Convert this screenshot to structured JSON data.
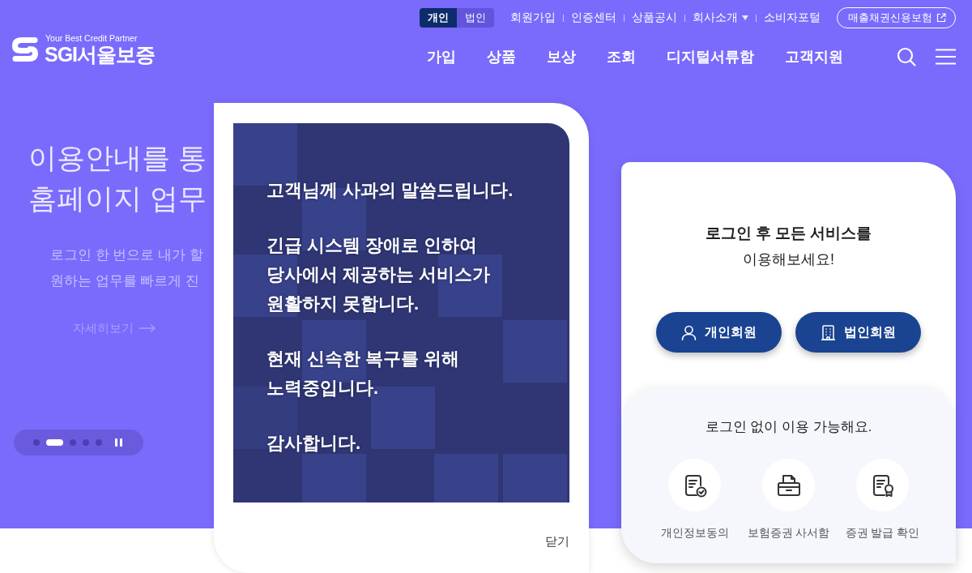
{
  "header": {
    "member_tabs": [
      {
        "label": "개인",
        "selected": true
      },
      {
        "label": "법인",
        "selected": false
      }
    ],
    "utility_links": [
      {
        "label": "회원가입",
        "kind": "link"
      },
      {
        "label": "인증센터",
        "kind": "link"
      },
      {
        "label": "상품공시",
        "kind": "link"
      },
      {
        "label": "회사소개",
        "kind": "dropdown"
      },
      {
        "label": "소비자포털",
        "kind": "link"
      }
    ],
    "external_button": {
      "label": "매출채권신용보험"
    },
    "logo": {
      "tagline": "Your Best Credit Partner",
      "name": "SGI서울보증"
    },
    "nav": [
      "가입",
      "상품",
      "보상",
      "조회",
      "디지털서류함",
      "고객지원"
    ]
  },
  "hero": {
    "headline": [
      "이용안내를 통",
      "홈페이지 업무"
    ],
    "description": [
      "로그인 한 번으로 내가 할",
      "원하는 업무를 빠르게 진"
    ],
    "more_link": "자세히보기",
    "carousel": {
      "slides": [
        {
          "selected": false
        },
        {
          "selected": true
        },
        {
          "selected": false
        },
        {
          "selected": false
        },
        {
          "selected": false
        }
      ],
      "playing": true
    }
  },
  "popup": {
    "paragraphs": [
      [
        "고객님께 사과의 말씀드립니다."
      ],
      [
        "긴급 시스템 장애로 인하여",
        "당사에서 제공하는 서비스가",
        "원활하지 못합니다."
      ],
      [
        "현재 신속한 복구를 위해",
        "노력중입니다."
      ],
      [
        "감사합니다."
      ]
    ],
    "close": "닫기"
  },
  "login_card": {
    "title": "로그인 후 모든 서비스를",
    "subtitle": "이용해보세요!",
    "buttons": [
      {
        "label": "개인회원",
        "kind": "person"
      },
      {
        "label": "법인회원",
        "kind": "company"
      }
    ],
    "guest_title": "로그인 없이 이용 가능해요.",
    "guest_services": [
      {
        "label": "개인정보동의",
        "kind": "consent"
      },
      {
        "label": "보험증권 사서함",
        "kind": "mailbox"
      },
      {
        "label": "증권 발급 확인",
        "kind": "certificate"
      }
    ]
  }
}
